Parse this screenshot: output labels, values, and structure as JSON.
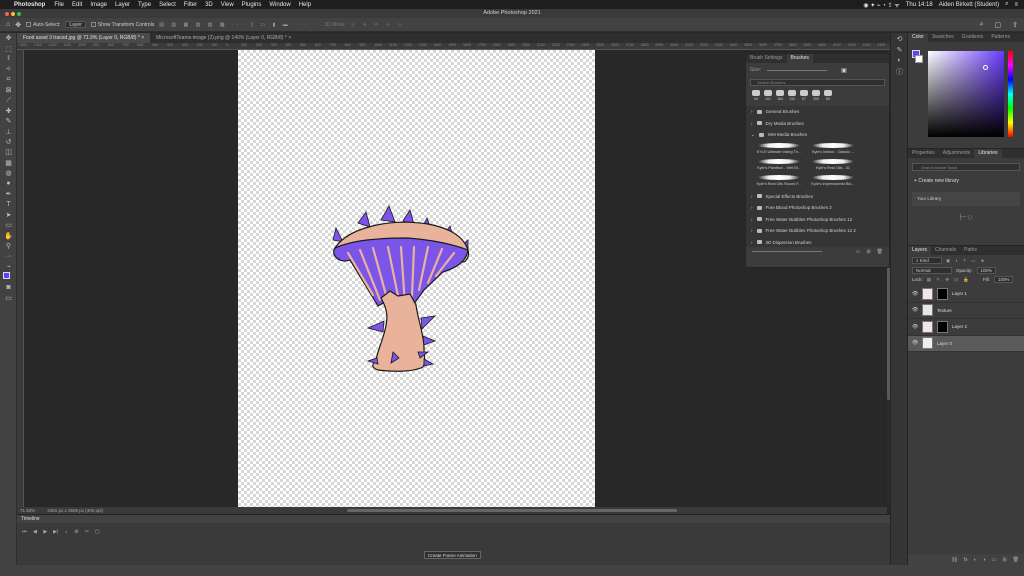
{
  "menubar": {
    "app_name": "Photoshop",
    "items": [
      "File",
      "Edit",
      "Image",
      "Layer",
      "Type",
      "Select",
      "Filter",
      "3D",
      "View",
      "Plugins",
      "Window",
      "Help"
    ],
    "clock": "Thu 14:18",
    "user": "Aiden Birkett (Student)"
  },
  "window": {
    "title": "Adobe Photoshop 2021"
  },
  "options_bar": {
    "auto_select_label": "Auto-Select:",
    "auto_select_value": "Layer",
    "show_transform_label": "Show Transform Controls",
    "mode_3d": "3D Mode:"
  },
  "doc_tabs": [
    {
      "label": "Food asset 3 traced.jpg @ 71.9% (Layer 0, RGB/8) *"
    },
    {
      "label": "MicrosoftTeams-image (2).png @ 140% (Layer 0, RGB/8) *"
    }
  ],
  "ruler_ticks": [
    "1400",
    "1300",
    "1200",
    "1100",
    "1000",
    "900",
    "800",
    "700",
    "600",
    "500",
    "400",
    "300",
    "200",
    "100",
    "0",
    "100",
    "200",
    "300",
    "400",
    "500",
    "600",
    "700",
    "800",
    "900",
    "1000",
    "1100",
    "1200",
    "1300",
    "1400",
    "1500",
    "1600",
    "1700",
    "1800",
    "1900",
    "2000",
    "2100",
    "2200",
    "2300",
    "2400",
    "2500",
    "2600",
    "2700",
    "2800",
    "2900",
    "3000",
    "3100",
    "3200",
    "3300",
    "3400",
    "3500",
    "3600",
    "3700",
    "3800",
    "3900",
    "4000",
    "4100",
    "4200",
    "4300",
    "4400"
  ],
  "status": {
    "zoom": "71.93%",
    "doc_size": "2481 px x 3509 px (300 ppi)"
  },
  "timeline": {
    "title": "Timeline",
    "create_button": "Create Frame Animation"
  },
  "brushes_panel": {
    "tabs": [
      "Brush Settings",
      "Brushes"
    ],
    "size_label": "Size:",
    "search_placeholder": "Search Brushes",
    "preset_sizes": [
      "64",
      "101",
      "164",
      "132",
      "57",
      "200",
      "80"
    ],
    "folders_top": [
      "General Brushes",
      "Dry Media Brushes",
      "Wet Media Brushes"
    ],
    "strokes": [
      "KYLE Ultimate Inking Th...",
      "Kyle's Inkbox - Classic ...",
      "Kyle's Paintbox - Wet Bl...",
      "Kyle's Real Oils - 31",
      "Kyle's Real Oils Round F...",
      "Kyle's Impressionist Blo..."
    ],
    "folders_bottom": [
      "Special Effects Brushes",
      "Free Blood Photoshop Brushes 2",
      "Free Water Bubbles Photoshop Brushes 12",
      "Free Water Bubbles Photoshop Brushes 12 2",
      "3D Dispersion Brushes"
    ]
  },
  "color_panel": {
    "tabs": [
      "Color",
      "Swatches",
      "Gradients",
      "Patterns"
    ],
    "fg_color": "#6a3cff",
    "bg_color": "#ffffff"
  },
  "libraries_panel": {
    "tabs": [
      "Properties",
      "Adjustments",
      "Libraries"
    ],
    "search_placeholder": "Search Adobe Stock",
    "create_label": "Create new library",
    "your_library": "Your Library"
  },
  "layers_panel": {
    "tabs": [
      "Layers",
      "Channels",
      "Paths"
    ],
    "filter": "Kind",
    "blend_mode": "Normal",
    "opacity_label": "Opacity:",
    "opacity_value": "100%",
    "lock_label": "Lock:",
    "fill_label": "Fill:",
    "fill_value": "100%",
    "layers": [
      {
        "name": "Layer 1"
      },
      {
        "name": "Texture"
      },
      {
        "name": "Layer 2"
      },
      {
        "name": "Layer 0"
      }
    ]
  },
  "artwork": {
    "cap_color": "#e8b39a",
    "gill_color": "#7a55e8",
    "outline_color": "#1a1a1a"
  }
}
